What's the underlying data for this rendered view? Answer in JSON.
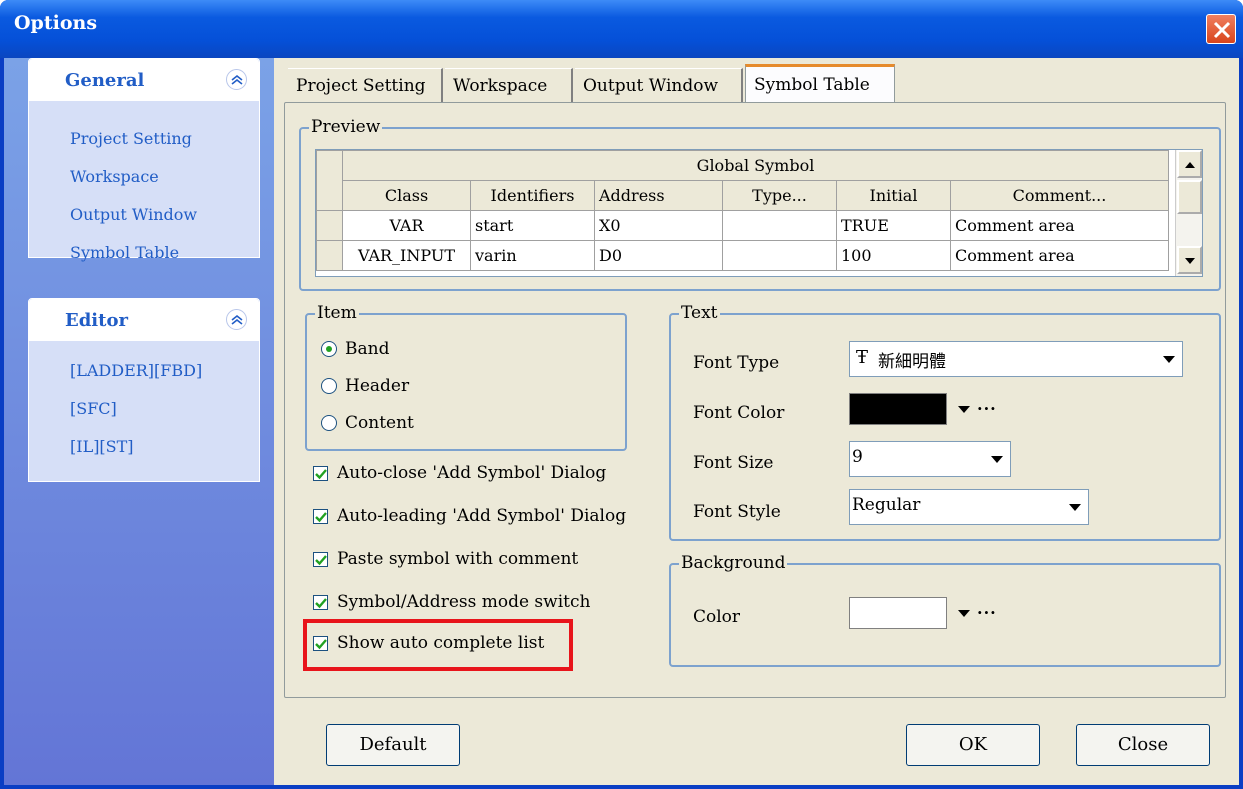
{
  "window": {
    "title": "Options"
  },
  "sidebar": {
    "general": {
      "title": "General",
      "items": [
        "Project Setting",
        "Workspace",
        "Output Window",
        "Symbol Table"
      ]
    },
    "editor": {
      "title": "Editor",
      "items": [
        "[LADDER][FBD]",
        "[SFC]",
        "[IL][ST]"
      ]
    }
  },
  "tabs": [
    "Project Setting",
    "Workspace",
    "Output Window",
    "Symbol Table"
  ],
  "active_tab": "Symbol Table",
  "preview": {
    "legend": "Preview",
    "grid_title": "Global Symbol",
    "columns": [
      "Class",
      "Identifiers",
      "Address",
      "Type...",
      "Initial",
      "Comment..."
    ],
    "rows": [
      [
        "VAR",
        "start",
        "X0",
        "",
        "TRUE",
        "Comment area"
      ],
      [
        "VAR_INPUT",
        "varin",
        "D0",
        "",
        "100",
        "Comment area"
      ]
    ]
  },
  "item": {
    "legend": "Item",
    "options": [
      "Band",
      "Header",
      "Content"
    ],
    "selected": "Band"
  },
  "checkboxes": [
    {
      "label": "Auto-close 'Add Symbol' Dialog",
      "checked": true
    },
    {
      "label": "Auto-leading 'Add Symbol' Dialog",
      "checked": true
    },
    {
      "label": "Paste symbol with comment",
      "checked": true
    },
    {
      "label": "Symbol/Address mode switch",
      "checked": true
    },
    {
      "label": "Show auto complete list",
      "checked": true
    }
  ],
  "text_group": {
    "legend": "Text",
    "font_type_label": "Font Type",
    "font_type_value": "新細明體",
    "font_color_label": "Font Color",
    "font_color": "#000000",
    "font_size_label": "Font Size",
    "font_size_value": "9",
    "font_style_label": "Font Style",
    "font_style_value": "Regular"
  },
  "background_group": {
    "legend": "Background",
    "color_label": "Color",
    "color": "#ffffff"
  },
  "buttons": {
    "default": "Default",
    "ok": "OK",
    "close": "Close"
  },
  "colors": {
    "highlight": "#e8141b",
    "accent": "#215dc6"
  }
}
